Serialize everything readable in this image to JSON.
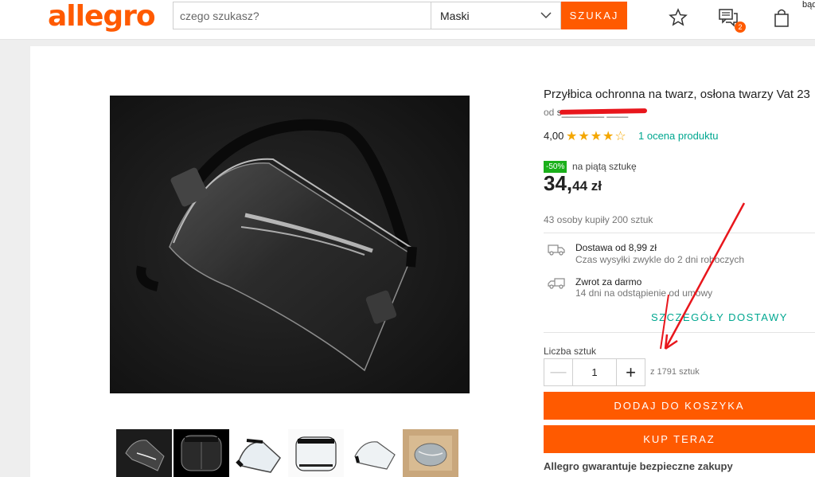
{
  "header": {
    "logo": "allegro",
    "search_placeholder": "czego szukasz?",
    "category": "Maski",
    "search_button": "SZUKAJ",
    "messages_badge": "2",
    "corner_text": "bąd"
  },
  "product": {
    "title": "Przyłbica ochronna na twarz, osłona twarzy Vat 23",
    "seller_prefix": "od",
    "seller_name": "s________ ____",
    "rating_value": "4,00",
    "stars": "★★★★☆",
    "rating_link": "1 ocena produktu",
    "discount_badge": "-50%",
    "discount_text": "na piątą sztukę",
    "price_main": "34,",
    "price_dec": "44",
    "price_currency": " zł",
    "sold": "43 osoby kupiły 200 sztuk"
  },
  "shipping": {
    "delivery_title": "Dostawa od 8,99 zł",
    "delivery_sub": "Czas wysyłki zwykle do 2 dni roboczych",
    "return_title": "Zwrot za darmo",
    "return_sub": "14 dni na odstąpienie od umowy",
    "details_link": "SZCZEGÓŁY DOSTAWY"
  },
  "quantity": {
    "label": "Liczba sztuk",
    "value": "1",
    "available": "z 1791 sztuk",
    "minus": "—",
    "plus": "+"
  },
  "actions": {
    "add_to_cart": "DODAJ DO KOSZYKA",
    "buy_now": "KUP TERAZ"
  },
  "guarantee": "Allegro gwarantuje bezpieczne zakupy",
  "colors": {
    "brand": "#ff5a00",
    "link": "#00a790",
    "star": "#f4a700",
    "discount": "#1bb01b",
    "annotation": "#e8161c"
  },
  "icons": [
    "star-outline-icon",
    "messages-icon",
    "shopping-bag-icon",
    "chevron-down-icon",
    "truck-icon",
    "return-truck-icon"
  ]
}
